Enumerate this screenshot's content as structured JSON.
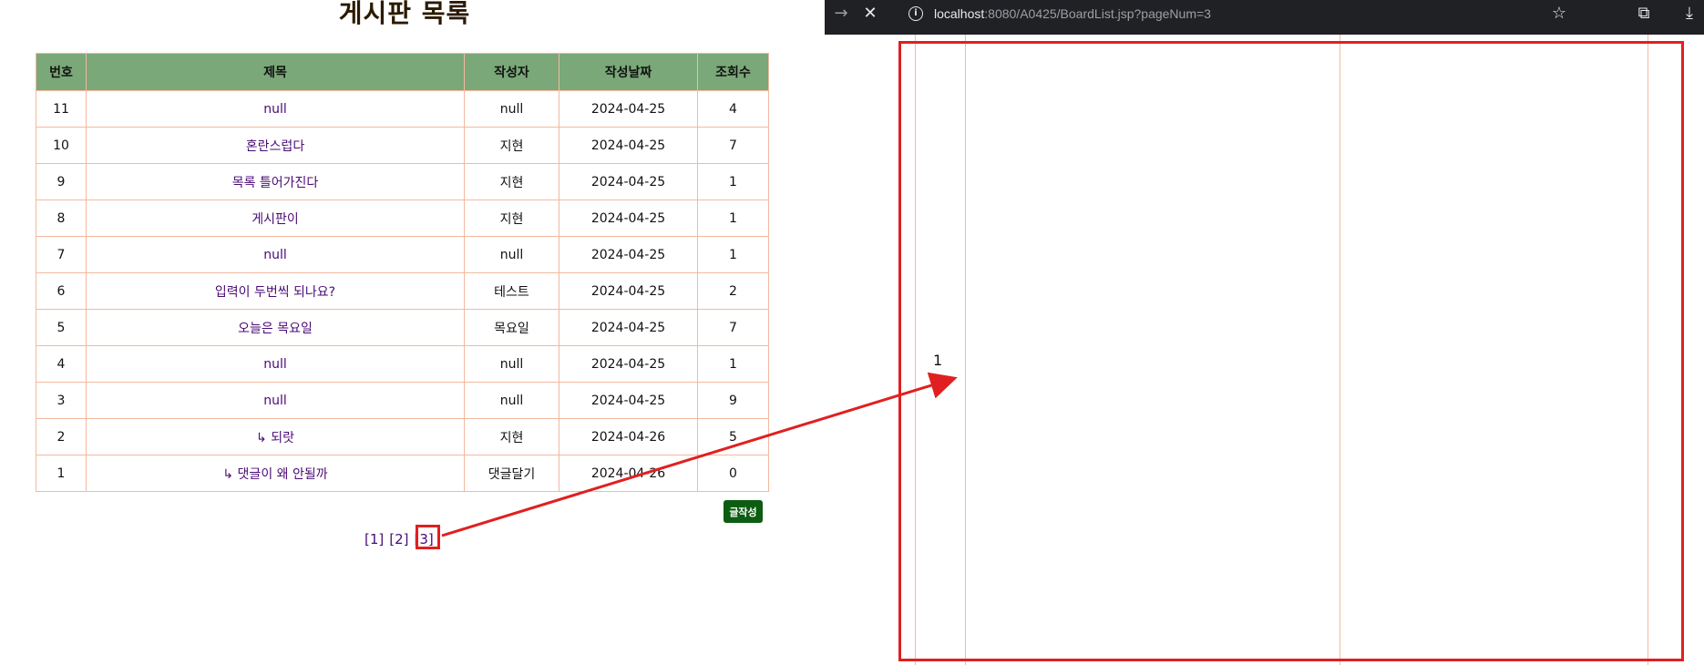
{
  "board": {
    "title": "게시판 목록",
    "columns": [
      "번호",
      "제목",
      "작성자",
      "작성날짜",
      "조회수"
    ],
    "rows": [
      {
        "num": "11",
        "title": "null",
        "author": "null",
        "date": "2024-04-25",
        "views": "4"
      },
      {
        "num": "10",
        "title": "혼란스럽다",
        "author": "지현",
        "date": "2024-04-25",
        "views": "7"
      },
      {
        "num": "9",
        "title": "목록 틀어가진다",
        "author": "지현",
        "date": "2024-04-25",
        "views": "1"
      },
      {
        "num": "8",
        "title": "게시판이",
        "author": "지현",
        "date": "2024-04-25",
        "views": "1"
      },
      {
        "num": "7",
        "title": "null",
        "author": "null",
        "date": "2024-04-25",
        "views": "1"
      },
      {
        "num": "6",
        "title": "입력이 두번씩 되나요?",
        "author": "테스트",
        "date": "2024-04-25",
        "views": "2"
      },
      {
        "num": "5",
        "title": "오늘은 목요일",
        "author": "목요일",
        "date": "2024-04-25",
        "views": "7"
      },
      {
        "num": "4",
        "title": "null",
        "author": "null",
        "date": "2024-04-25",
        "views": "1"
      },
      {
        "num": "3",
        "title": "null",
        "author": "null",
        "date": "2024-04-25",
        "views": "9"
      },
      {
        "num": "2",
        "title": "↳ 되랏",
        "author": "지현",
        "date": "2024-04-26",
        "views": "5"
      },
      {
        "num": "1",
        "title": "↳ 댓글이 왜 안될까",
        "author": "댓글달기",
        "date": "2024-04-26",
        "views": "0"
      }
    ],
    "write_button": "글작성",
    "pages": [
      "[1]",
      "[2]",
      "[3]"
    ]
  },
  "browser": {
    "url_host": "localhost",
    "url_rest": ":8080/A0425/BoardList.jsp?pageNum=3",
    "content_value": "1"
  },
  "colors": {
    "header_bg": "#7aa878",
    "border": "#f4b89f",
    "link": "#4a0b75",
    "button_bg": "#0c5c12",
    "annotation_red": "#e02020"
  },
  "icons": {
    "forward": "forward-arrow-icon",
    "stop": "close-icon",
    "info": "info-icon",
    "bookmark": "star-icon",
    "extensions": "puzzle-icon",
    "download": "download-icon"
  }
}
